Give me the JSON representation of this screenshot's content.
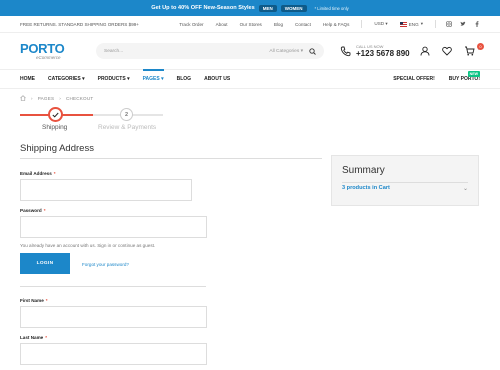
{
  "promo": {
    "text": "Get Up to 40% OFF New-Season Styles",
    "men": "MEN",
    "women": "WOMEN",
    "note": "* Limited time only"
  },
  "util": {
    "shipping": "FREE RETURNS. STANDARD SHIPPING ORDERS $99+",
    "links": [
      "Track Order",
      "About",
      "Our Stores",
      "Blog",
      "Contact",
      "Help & FAQs"
    ],
    "currency": "USD",
    "language": "ENG"
  },
  "header": {
    "logo": "PORTO",
    "logo_sub": "eCommerce",
    "search_placeholder": "Search...",
    "search_category": "All Categories",
    "call_label": "CALL US NOW",
    "call_number": "+123 5678 890",
    "cart_count": "0"
  },
  "nav": {
    "items": [
      "HOME",
      "CATEGORIES",
      "PRODUCTS",
      "PAGES",
      "BLOG",
      "ABOUT US"
    ],
    "right": [
      "SPECIAL OFFER!",
      "BUY PORTO!"
    ],
    "new_badge": "NEW"
  },
  "breadcrumb": [
    "PAGES",
    "CHECKOUT"
  ],
  "steps": {
    "step1_label": "Shipping",
    "step2_number": "2",
    "step2_label": "Review & Payments"
  },
  "form": {
    "title": "Shipping Address",
    "email_label": "Email Address",
    "password_label": "Password",
    "hint": "You already have an account with us. Sign in or continue as guest.",
    "login_button": "LOGIN",
    "forgot": "Forgot your password?",
    "first_name_label": "First Name",
    "last_name_label": "Last Name",
    "required": "*"
  },
  "summary": {
    "title": "Summary",
    "cart_text": "3 products in Cart"
  },
  "colors": {
    "primary": "#1c87c9",
    "accent": "#e8523f",
    "new_badge": "#0cc485"
  }
}
